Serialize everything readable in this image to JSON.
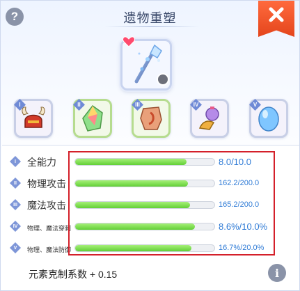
{
  "header": {
    "title": "遗物重塑",
    "help_symbol": "?",
    "info_symbol": "i",
    "close_icon": "close-x-icon"
  },
  "main_relic": {
    "icon": "crystal-staff-icon",
    "favorite_icon": "heart-icon",
    "link_icon": "link-badge-icon"
  },
  "slots": [
    {
      "numeral": "I",
      "icon": "red-horned-helmet-icon",
      "selected": false
    },
    {
      "numeral": "II",
      "icon": "rainbow-crystal-icon",
      "selected": true
    },
    {
      "numeral": "III",
      "icon": "red-ore-icon",
      "selected": true
    },
    {
      "numeral": "IV",
      "icon": "potion-horn-icon",
      "selected": false
    },
    {
      "numeral": "V",
      "icon": "blue-gem-icon",
      "selected": false
    }
  ],
  "stats": [
    {
      "numeral": "I",
      "name": "全能力",
      "value_text": "8.0/10.0",
      "fill": 0.8
    },
    {
      "numeral": "II",
      "name": "物理攻击",
      "value_text": "162.2/200.0",
      "fill": 0.811
    },
    {
      "numeral": "III",
      "name": "魔法攻击",
      "value_text": "165.2/200.0",
      "fill": 0.826
    },
    {
      "numeral": "IV",
      "name": "物理、魔法穿刺",
      "value_text": "8.6%/10.0%",
      "fill": 0.86
    },
    {
      "numeral": "V",
      "name": "物理、魔法防御",
      "value_text": "16.7%/20.0%",
      "fill": 0.835
    }
  ],
  "element_coefficient": "元素克制系数 + 0.15",
  "colors": {
    "bar_fill": "#62cf36",
    "value_text": "#2f7bd6",
    "close_button": "#e4451c",
    "highlight": "#d4202a"
  }
}
